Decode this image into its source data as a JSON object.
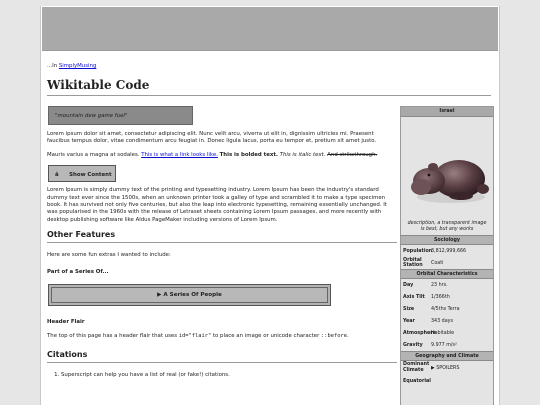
{
  "breadcrumb": {
    "prefix": "...In ",
    "link": "SimplyMusing"
  },
  "title": "Wikitable Code",
  "quote": "\"mountain dew game fuel\"",
  "para1": "Lorem ipsum dolor sit amet, consectetur adipiscing elit. Nunc velit arcu, viverra ut elit in, dignissim ultricies mi. Praesent faucibus tempus dolor, vitae condimentum arcu feugiat in. Donec ligula lacus, porta eu tempor et, pretium sit amet justo.",
  "para2": {
    "text": "Mauris varius a magna at sodales. ",
    "link": "This is what a link looks like.",
    "bold": "This is bolded text.",
    "italic": "This is italic text.",
    "strike": "And strikethrough."
  },
  "show_content_label": "â Show Content",
  "para3": "Lorem Ipsum is simply dummy text of the printing and typesetting industry. Lorem Ipsum has been the industry's standard dummy text ever since the 1500s, when an unknown printer took a galley of type and scrambled it to make a type specimen book. It has survived not only five centuries, but also the leap into electronic typesetting, remaining essentially unchanged. It was popularised in the 1960s with the release of Letraset sheets containing Lorem Ipsum passages, and more recently with desktop publishing software like Aldus PageMaker including versions of Lorem Ipsum.",
  "other_features": {
    "heading": "Other Features",
    "intro": "Here are some fun extras I wanted to include:",
    "series_title": "Part of a Series Of...",
    "series_button": "▶ A Series Of People",
    "flair_title": "Header Flair",
    "flair_text_1": "The top of this page has a header flair that uses ",
    "flair_code_1": "id=\"flair\"",
    "flair_text_2": " to place an image or unicode character ",
    "flair_code_2": "::before",
    "flair_text_3": "."
  },
  "citations": {
    "heading": "Citations",
    "items": [
      "Superscript can help you have a list of real (or fake!) citations."
    ]
  },
  "infobox": {
    "title": "Israel",
    "caption": "description, a transparent image is best, but any works",
    "sections": [
      {
        "heading": "Sociology",
        "rows": [
          {
            "key": "Population",
            "value": "3,812,999,666"
          },
          {
            "key": "Orbital Station",
            "value": "Coati"
          }
        ]
      },
      {
        "heading": "Orbital Characteristics",
        "rows": [
          {
            "key": "Day",
            "value": "23 hrs."
          },
          {
            "key": "Axis Tilt",
            "value": "1/366th"
          },
          {
            "key": "Size",
            "value": "4/5ths Terra"
          },
          {
            "key": "Year",
            "value": "343 days"
          },
          {
            "key": "Atmosphere",
            "value": "Habitable"
          },
          {
            "key": "Gravity",
            "value": "9.977 m/s²"
          }
        ]
      },
      {
        "heading": "Geography and Climate",
        "rows": [
          {
            "key_line1": "Dominant",
            "key_line2": "Climate",
            "value": "▶ SPOILERS"
          },
          {
            "key_line1": "Equatorial",
            "key_line2": "",
            "value": ""
          }
        ]
      }
    ]
  }
}
